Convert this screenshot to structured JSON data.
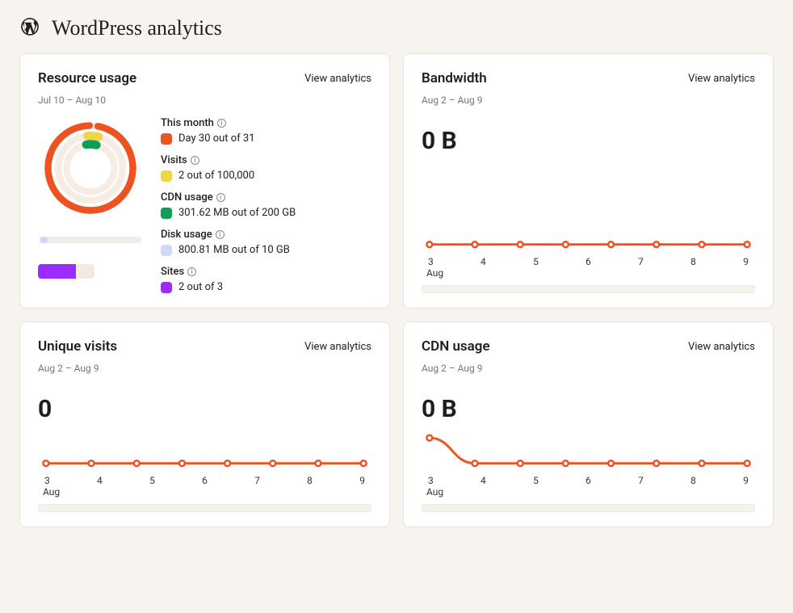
{
  "page_title": "WordPress analytics",
  "view_analytics_label": "View analytics",
  "resource": {
    "title": "Resource usage",
    "range": "Jul 10 – Aug 10",
    "this_month": {
      "label": "This month",
      "chip": "#ed5221",
      "value": "Day 30 out of 31"
    },
    "visits": {
      "label": "Visits",
      "chip": "#f2d545",
      "value": "2 out of 100,000"
    },
    "cdn": {
      "label": "CDN usage",
      "chip": "#0f9d58",
      "value": "301.62 MB out of 200 GB"
    },
    "disk": {
      "label": "Disk usage",
      "chip": "#cfd9f7",
      "value": "800.81 MB out of 10 GB"
    },
    "sites": {
      "label": "Sites",
      "chip": "#9b2bff",
      "value": "2 out of 3"
    }
  },
  "bandwidth": {
    "title": "Bandwidth",
    "range": "Aug 2 – Aug 9",
    "stat": "0 B"
  },
  "unique": {
    "title": "Unique visits",
    "range": "Aug 2 – Aug 9",
    "stat": "0"
  },
  "cdn": {
    "title": "CDN usage",
    "range": "Aug 2 – Aug 9",
    "stat": "0 B"
  },
  "chart_data": {
    "resource_gauges": {
      "type": "radial-gauge",
      "items": [
        {
          "name": "This month",
          "value": 30,
          "max": 31,
          "color": "#ed5221"
        },
        {
          "name": "Visits",
          "value": 2,
          "max": 100000,
          "color": "#f2d545"
        },
        {
          "name": "CDN usage (MB)",
          "value": 301.62,
          "max": 204800,
          "color": "#0f9d58"
        },
        {
          "name": "Disk usage (MB)",
          "value": 800.81,
          "max": 10240,
          "color": "#cfd9f7"
        },
        {
          "name": "Sites",
          "value": 2,
          "max": 3,
          "color": "#9b2bff"
        }
      ]
    },
    "bandwidth": {
      "type": "line",
      "title": "Bandwidth",
      "xlabel": "Aug",
      "ylabel": "",
      "x": [
        2,
        3,
        4,
        5,
        6,
        7,
        8,
        9
      ],
      "y": [
        0,
        0,
        0,
        0,
        0,
        0,
        0,
        0
      ],
      "ylim": [
        0,
        1
      ]
    },
    "unique_visits": {
      "type": "line",
      "title": "Unique visits",
      "xlabel": "Aug",
      "ylabel": "",
      "x": [
        2,
        3,
        4,
        5,
        6,
        7,
        8,
        9
      ],
      "y": [
        0,
        0,
        0,
        0,
        0,
        0,
        0,
        0
      ],
      "ylim": [
        0,
        1
      ]
    },
    "cdn_usage": {
      "type": "line",
      "title": "CDN usage",
      "xlabel": "Aug",
      "ylabel": "",
      "x": [
        2,
        3,
        4,
        5,
        6,
        7,
        8,
        9
      ],
      "y": [
        40,
        0,
        0,
        0,
        0,
        0,
        0,
        0
      ],
      "ylim": [
        0,
        50
      ]
    },
    "axis_ticks": [
      "3",
      "4",
      "5",
      "6",
      "7",
      "8",
      "9"
    ],
    "axis_month": "Aug"
  }
}
